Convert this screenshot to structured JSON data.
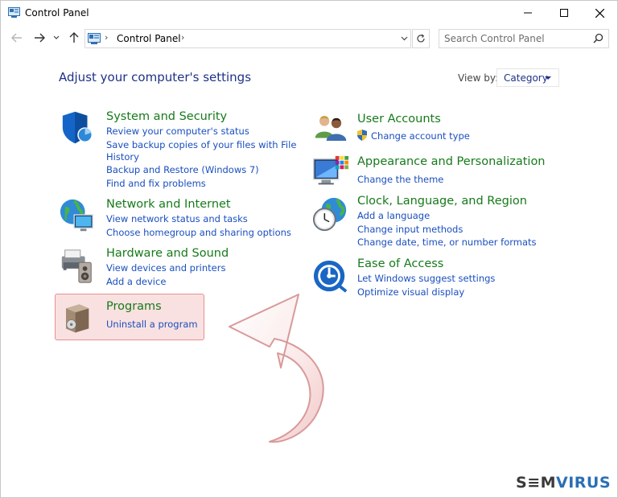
{
  "window": {
    "title": "Control Panel"
  },
  "address": {
    "path": "Control Panel",
    "separator": "›"
  },
  "search": {
    "placeholder": "Search Control Panel"
  },
  "main": {
    "heading": "Adjust your computer's settings",
    "view_by_label": "View by:",
    "view_by_value": "Category"
  },
  "categories": [
    {
      "title": "System and Security",
      "icon": "shield-icon",
      "links": [
        "Review your computer's status",
        "Save backup copies of your files with File",
        "History",
        "Backup and Restore (Windows 7)",
        "Find and fix problems"
      ]
    },
    {
      "title": "Network and Internet",
      "icon": "globe-network-icon",
      "links": [
        "View network status and tasks",
        "Choose homegroup and sharing options"
      ]
    },
    {
      "title": "Hardware and Sound",
      "icon": "printer-speaker-icon",
      "links": [
        "View devices and printers",
        "Add a device"
      ]
    },
    {
      "title": "Programs",
      "icon": "programs-box-icon",
      "links": [
        "Uninstall a program"
      ]
    },
    {
      "title": "User Accounts",
      "icon": "users-icon",
      "links": [
        "Change account type"
      ]
    },
    {
      "title": "Appearance and Personalization",
      "icon": "monitor-palette-icon",
      "links": [
        "Change the theme"
      ]
    },
    {
      "title": "Clock, Language, and Region",
      "icon": "clock-globe-icon",
      "links": [
        "Add a language",
        "Change input methods",
        "Change date, time, or number formats"
      ]
    },
    {
      "title": "Ease of Access",
      "icon": "ease-of-access-icon",
      "links": [
        "Let Windows suggest settings",
        "Optimize visual display"
      ]
    }
  ],
  "watermark": {
    "part1": "S",
    "part2": "≡M",
    "part3": "VIRUS"
  },
  "colors": {
    "category_title": "#167a1a",
    "link": "#1a4fbf",
    "heading": "#1e3287",
    "highlight_border": "#e88f8f"
  }
}
